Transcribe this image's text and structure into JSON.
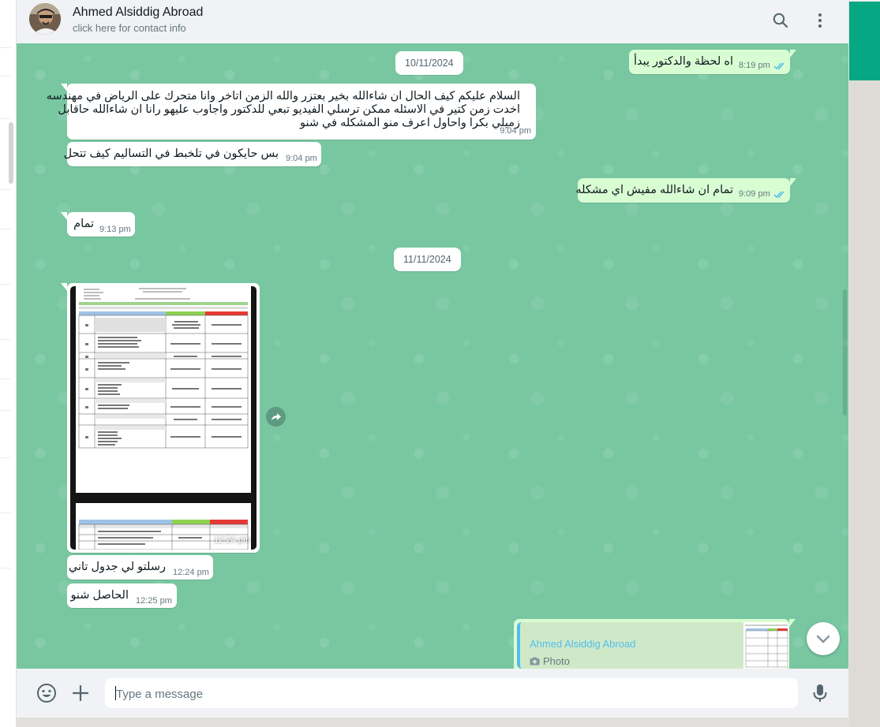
{
  "header": {
    "contact_name": "Ahmed Alsiddig Abroad",
    "contact_sub": "click here for contact info"
  },
  "dates": [
    "10/11/2024",
    "11/11/2024"
  ],
  "messages": [
    {
      "dir": "out",
      "text": "اه لحظة والدكتور يبدأ",
      "time": "8:19 pm",
      "read": true
    },
    {
      "dir": "in",
      "lines": [
        "السلام عليكم كيف الحال ان شاءالله بخير بعتزر والله الزمن اتاخر وانا متحرك على الرياض في مهندسه",
        "اخدت زمن كتير في الاسئله ممكن ترسلي الفيديو تبعي للدكتور واجاوب عليهو  رانا ان شاءالله حاقابل",
        "زميلي بكرا واحاول اعرف منو المشكله في شنو"
      ],
      "time": "9:04 pm"
    },
    {
      "dir": "in",
      "text": "بس حايكون في تلخبط في التساليم كيف تتحل",
      "time": "9:04 pm"
    },
    {
      "dir": "out",
      "text": "تمام ان شاءالله مفيش اي مشكله",
      "time": "9:09 pm",
      "read": true
    },
    {
      "dir": "in",
      "text": "تمام",
      "time": "9:13 pm"
    },
    {
      "dir": "in",
      "type": "image",
      "time": "12:24 pm"
    },
    {
      "dir": "in",
      "text": "رسلتو لي جدول تاني",
      "time": "12:24 pm"
    },
    {
      "dir": "in",
      "text": "الحاصل شنو",
      "time": "12:25 pm"
    }
  ],
  "reply_preview": {
    "name": "Ahmed Alsiddig Abroad",
    "type": "Photo"
  },
  "footer": {
    "placeholder": "Type a message"
  },
  "icons": {
    "search": "search-icon",
    "menu": "kebab-menu-icon",
    "emoji": "emoji-icon",
    "attach": "plus-icon",
    "mic": "microphone-icon",
    "scroll": "chevron-down-icon",
    "forward": "forward-icon",
    "read": "double-check-icon"
  },
  "colors": {
    "chat_bg": "#78c7a1",
    "incoming": "#ffffff",
    "outgoing": "#d9fdd3",
    "read_ticks": "#53bdeb",
    "accent": "#06a884"
  }
}
